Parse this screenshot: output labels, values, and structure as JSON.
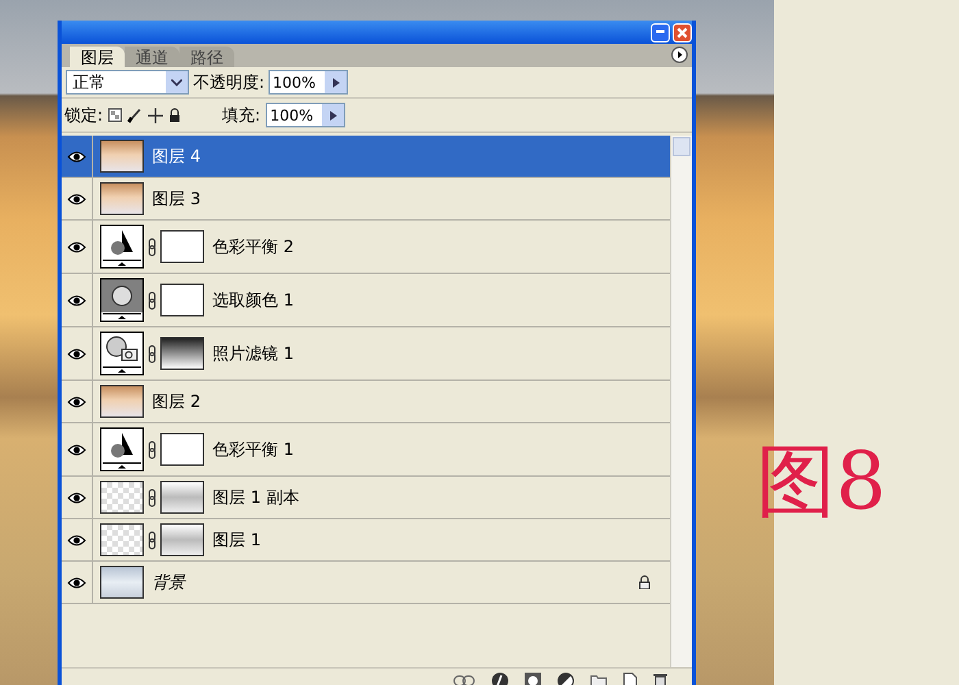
{
  "panel": {
    "tabs": [
      {
        "label": "图层",
        "selected": true
      },
      {
        "label": "通道",
        "selected": false
      },
      {
        "label": "路径",
        "selected": false
      }
    ],
    "blend_mode": {
      "value": "正常"
    },
    "opacity": {
      "label": "不透明度:",
      "value": "100%"
    },
    "lock": {
      "label": "锁定:"
    },
    "fill": {
      "label": "填充:",
      "value": "100%"
    },
    "layers": [
      {
        "name": "图层 4",
        "kind": "pixel",
        "visible": true,
        "selected": true,
        "locked": false
      },
      {
        "name": "图层 3",
        "kind": "pixel",
        "visible": true,
        "selected": false,
        "locked": false
      },
      {
        "name": "色彩平衡 2",
        "kind": "balance",
        "visible": true,
        "selected": false,
        "locked": false
      },
      {
        "name": "选取颜色 1",
        "kind": "selective",
        "visible": true,
        "selected": false,
        "locked": false
      },
      {
        "name": "照片滤镜 1",
        "kind": "photofilter",
        "visible": true,
        "selected": false,
        "locked": false
      },
      {
        "name": "图层 2",
        "kind": "pixel",
        "visible": true,
        "selected": false,
        "locked": false
      },
      {
        "name": "色彩平衡 1",
        "kind": "balance",
        "visible": true,
        "selected": false,
        "locked": false
      },
      {
        "name": "图层 1 副本",
        "kind": "masked",
        "visible": true,
        "selected": false,
        "locked": false
      },
      {
        "name": "图层 1",
        "kind": "masked",
        "visible": true,
        "selected": false,
        "locked": false
      },
      {
        "name": "背景",
        "kind": "background",
        "visible": true,
        "selected": false,
        "locked": true
      }
    ]
  },
  "figure_label": "图8"
}
